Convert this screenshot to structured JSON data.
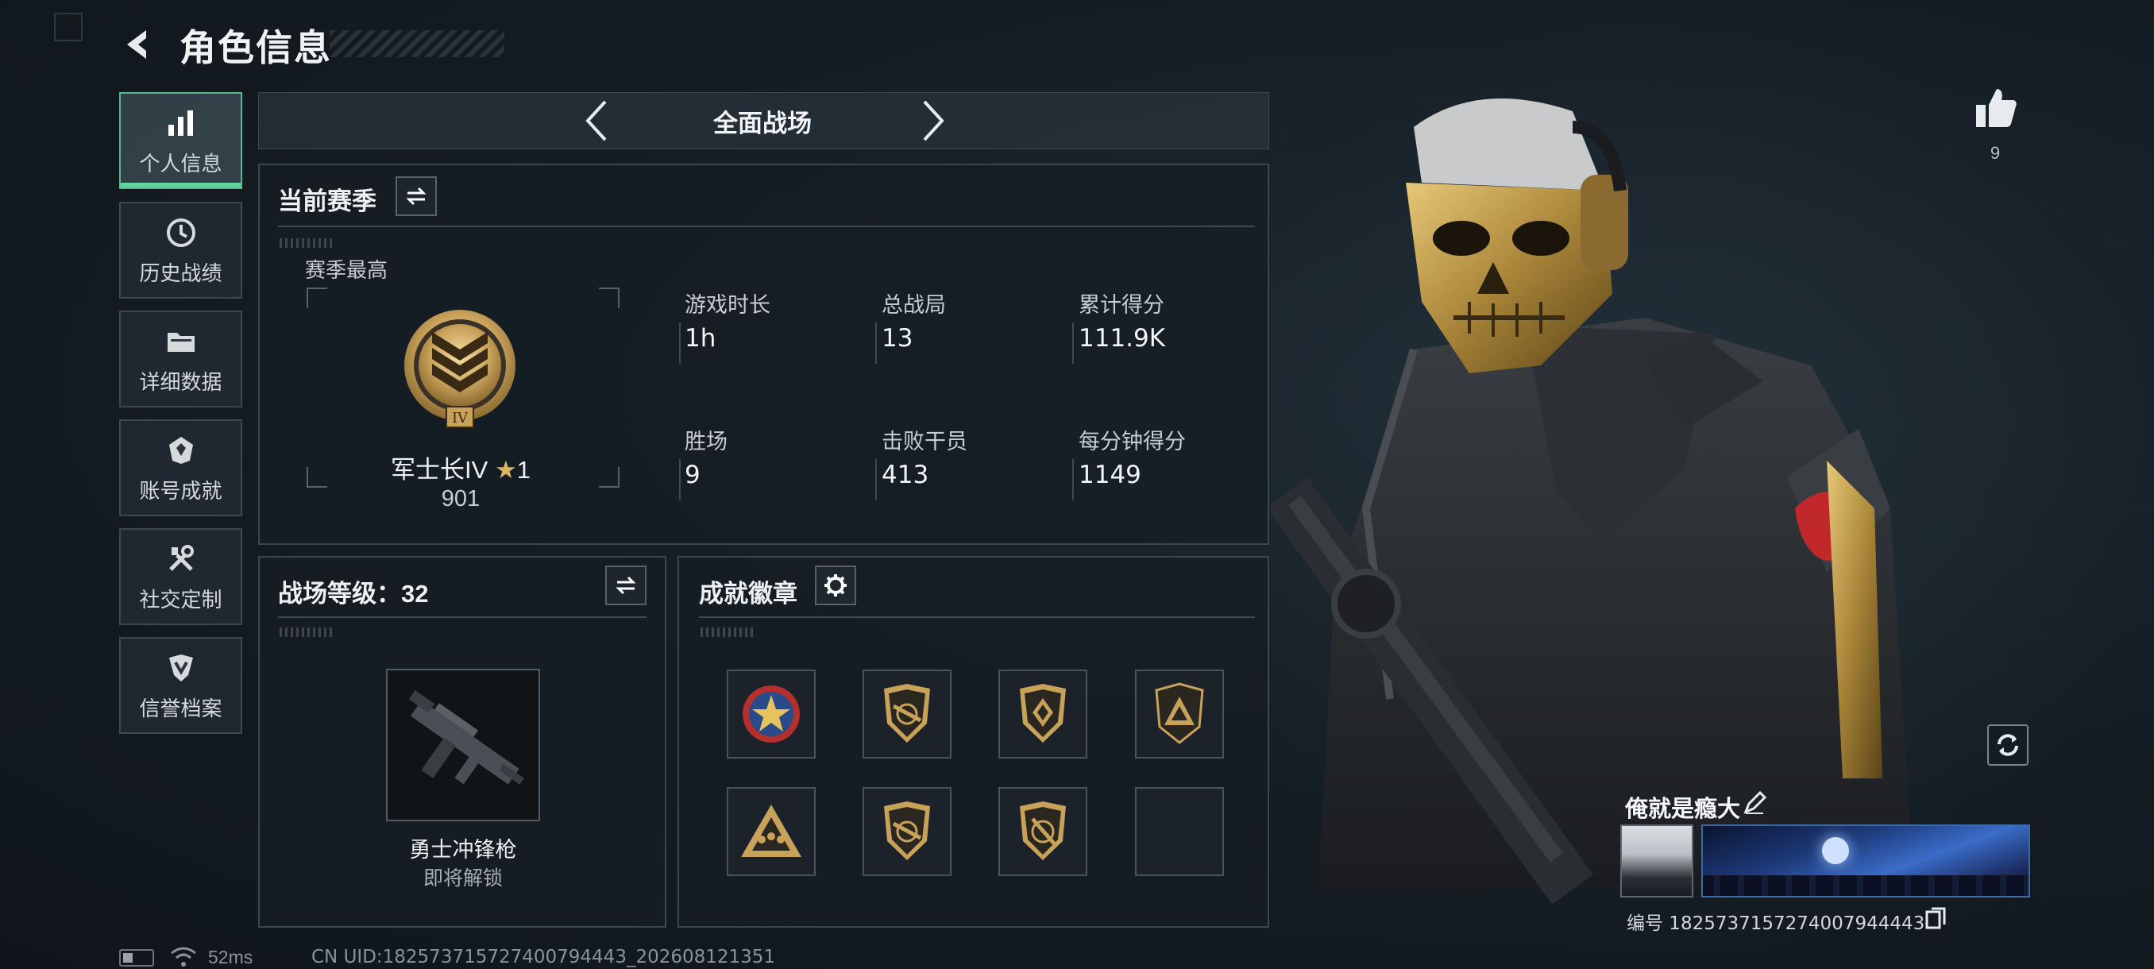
{
  "header": {
    "title": "角色信息"
  },
  "sidebar": {
    "items": [
      {
        "label": "个人信息",
        "icon": "bar-chart-icon",
        "active": true
      },
      {
        "label": "历史战绩",
        "icon": "history-icon"
      },
      {
        "label": "详细数据",
        "icon": "folder-icon"
      },
      {
        "label": "账号成就",
        "icon": "achievement-icon"
      },
      {
        "label": "社交定制",
        "icon": "tools-icon"
      },
      {
        "label": "信誉档案",
        "icon": "credit-shield-icon"
      }
    ]
  },
  "mode_selector": {
    "label": "全面战场"
  },
  "season_panel": {
    "title": "当前赛季",
    "season_best_label": "赛季最高",
    "rank": {
      "name": "军士长IV",
      "stars": "1",
      "score": "901",
      "badge_numeral": "IV"
    },
    "stats": [
      {
        "label": "游戏时长",
        "value": "1h"
      },
      {
        "label": "总战局",
        "value": "13"
      },
      {
        "label": "累计得分",
        "value": "111.9K"
      },
      {
        "label": "胜场",
        "value": "9"
      },
      {
        "label": "击败干员",
        "value": "413"
      },
      {
        "label": "每分钟得分",
        "value": "1149"
      }
    ]
  },
  "battlefield_level_panel": {
    "title": "战场等级：32",
    "weapon": {
      "name": "勇士冲锋枪",
      "status": "即将解锁"
    }
  },
  "badges_panel": {
    "title": "成就徽章",
    "badges": [
      {
        "icon": "star-emblem-badge-icon",
        "empty": false
      },
      {
        "icon": "rifle-shield-badge-icon",
        "empty": false
      },
      {
        "icon": "diamond-shield-badge-icon",
        "empty": false
      },
      {
        "icon": "triangle-badge-icon",
        "empty": false
      },
      {
        "icon": "triangle-squad-badge-icon",
        "empty": false
      },
      {
        "icon": "rifle-shield-badge-icon",
        "empty": false
      },
      {
        "icon": "blade-shield-badge-icon",
        "empty": false
      },
      {
        "icon": "",
        "empty": true
      }
    ]
  },
  "profile": {
    "likes": "9",
    "player_name": "俺就是瘾大",
    "id_label": "编号 1825737157274007944443"
  },
  "status_bar": {
    "ping": "52ms",
    "uid": "CN UID:182573715727400794443_202608121351"
  },
  "colors": {
    "accent": "#5fd3a0",
    "gold": "#c9a25a",
    "panel": "#161e24"
  }
}
